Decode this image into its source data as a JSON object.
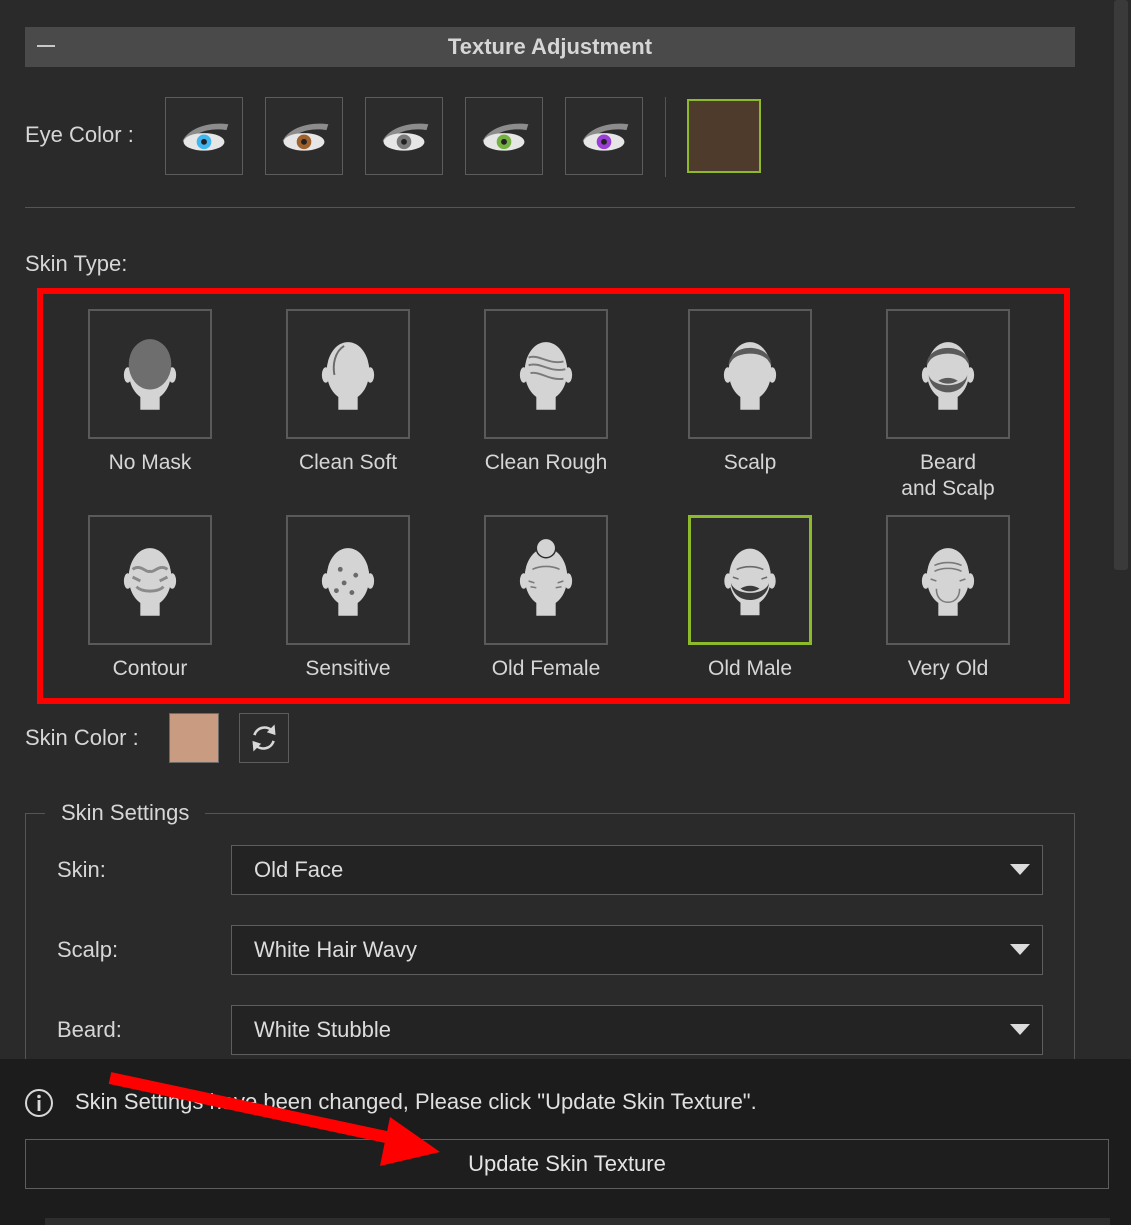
{
  "panel": {
    "title": "Texture Adjustment"
  },
  "eye_color": {
    "label": "Eye Color :",
    "options": [
      {
        "name": "blue",
        "iris": "#3fb6f0"
      },
      {
        "name": "brown",
        "iris": "#a0622d"
      },
      {
        "name": "gray",
        "iris": "#7a7a7a"
      },
      {
        "name": "green",
        "iris": "#74b140"
      },
      {
        "name": "purple",
        "iris": "#9a3ed4"
      }
    ],
    "custom_color": "#4f3b2b"
  },
  "skin_type": {
    "label": "Skin Type:",
    "items": [
      {
        "label": "No Mask",
        "icon": "head-no-mask-icon"
      },
      {
        "label": "Clean Soft",
        "icon": "head-clean-soft-icon"
      },
      {
        "label": "Clean Rough",
        "icon": "head-clean-rough-icon"
      },
      {
        "label": "Scalp",
        "icon": "head-scalp-icon"
      },
      {
        "label": "Beard\nand Scalp",
        "icon": "head-beard-scalp-icon"
      },
      {
        "label": "Contour",
        "icon": "head-contour-icon"
      },
      {
        "label": "Sensitive",
        "icon": "head-sensitive-icon"
      },
      {
        "label": "Old Female",
        "icon": "head-old-female-icon"
      },
      {
        "label": "Old Male",
        "icon": "head-old-male-icon",
        "selected": true
      },
      {
        "label": "Very Old",
        "icon": "head-very-old-icon"
      }
    ]
  },
  "skin_color": {
    "label": "Skin Color :",
    "color": "#c99b81"
  },
  "skin_settings": {
    "legend": "Skin Settings",
    "skin": {
      "label": "Skin:",
      "value": "Old Face"
    },
    "scalp": {
      "label": "Scalp:",
      "value": "White Hair Wavy"
    },
    "beard": {
      "label": "Beard:",
      "value": "White Stubble"
    }
  },
  "notification": {
    "text": "Skin Settings have been changed, Please click \"Update Skin Texture\".",
    "button_label": "Update Skin Texture"
  },
  "colors": {
    "selected_border": "#8dba2a",
    "highlight_annotation": "#ff0000"
  }
}
